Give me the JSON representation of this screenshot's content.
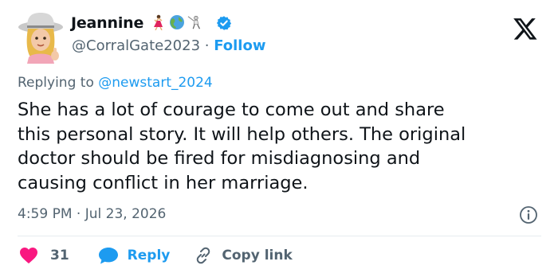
{
  "user": {
    "name": "Jeannine",
    "handle": "@CorralGate2023",
    "separator": " · ",
    "follow_label": "Follow",
    "emojis": [
      "woman-dancing-icon",
      "globe-icon",
      "fencer-icon"
    ],
    "verified_color": "#1d9bf0"
  },
  "reply": {
    "prefix": "Replying to ",
    "to": "@newstart_2024"
  },
  "tweet": {
    "lines": [
      "She has a lot of courage to come out and share",
      "this personal story. It will help others. The original",
      "doctor should be fired for misdiagnosing and",
      "causing conflict in her marriage."
    ],
    "timestamp": "4:59 PM · Jul 23, 2026"
  },
  "actions": {
    "like_count": "31",
    "reply_label": "Reply",
    "copy_label": "Copy link"
  },
  "colors": {
    "accent": "#1d9bf0",
    "like": "#f91880",
    "muted": "#536471",
    "text": "#0f1419"
  }
}
